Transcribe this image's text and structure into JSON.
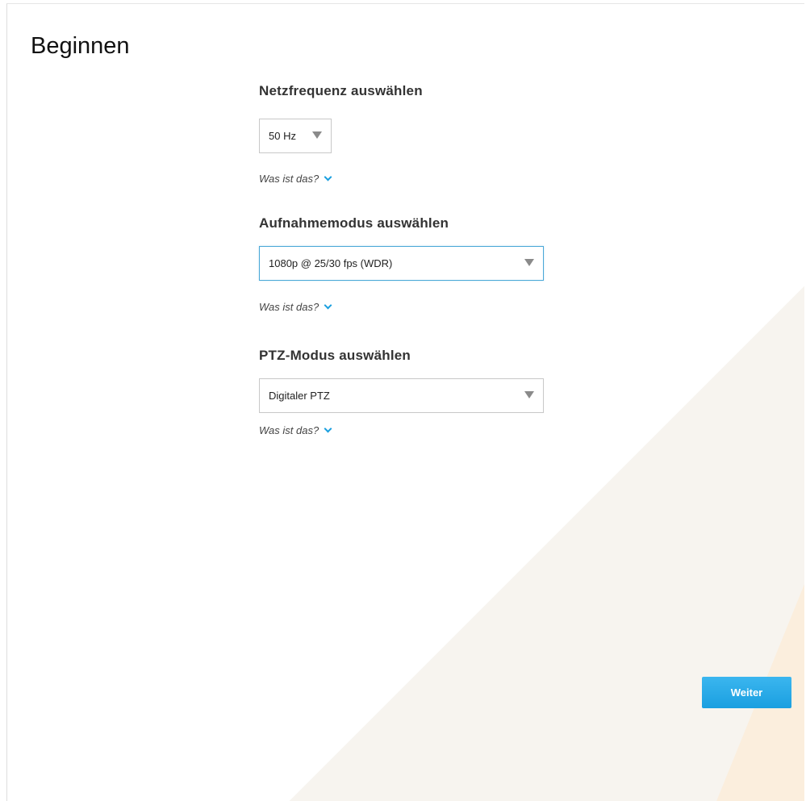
{
  "page": {
    "title": "Beginnen"
  },
  "sections": [
    {
      "title": "Netzfrequenz auswählen",
      "selected": "50 Hz",
      "help": "Was ist das?"
    },
    {
      "title": "Aufnahmemodus auswählen",
      "selected": "1080p @ 25/30 fps (WDR)",
      "help": "Was ist das?"
    },
    {
      "title": "PTZ-Modus auswählen",
      "selected": "Digitaler PTZ",
      "help": "Was ist das?"
    }
  ],
  "footer": {
    "next_label": "Weiter"
  },
  "colors": {
    "accent": "#1a9fe0",
    "focus_border": "#4aa8d8",
    "background_shape": "#f7f4ef",
    "corner_accent": "#fde7c4"
  },
  "icons": {
    "dropdown": "triangle-down",
    "help_toggle": "chevron-down"
  }
}
